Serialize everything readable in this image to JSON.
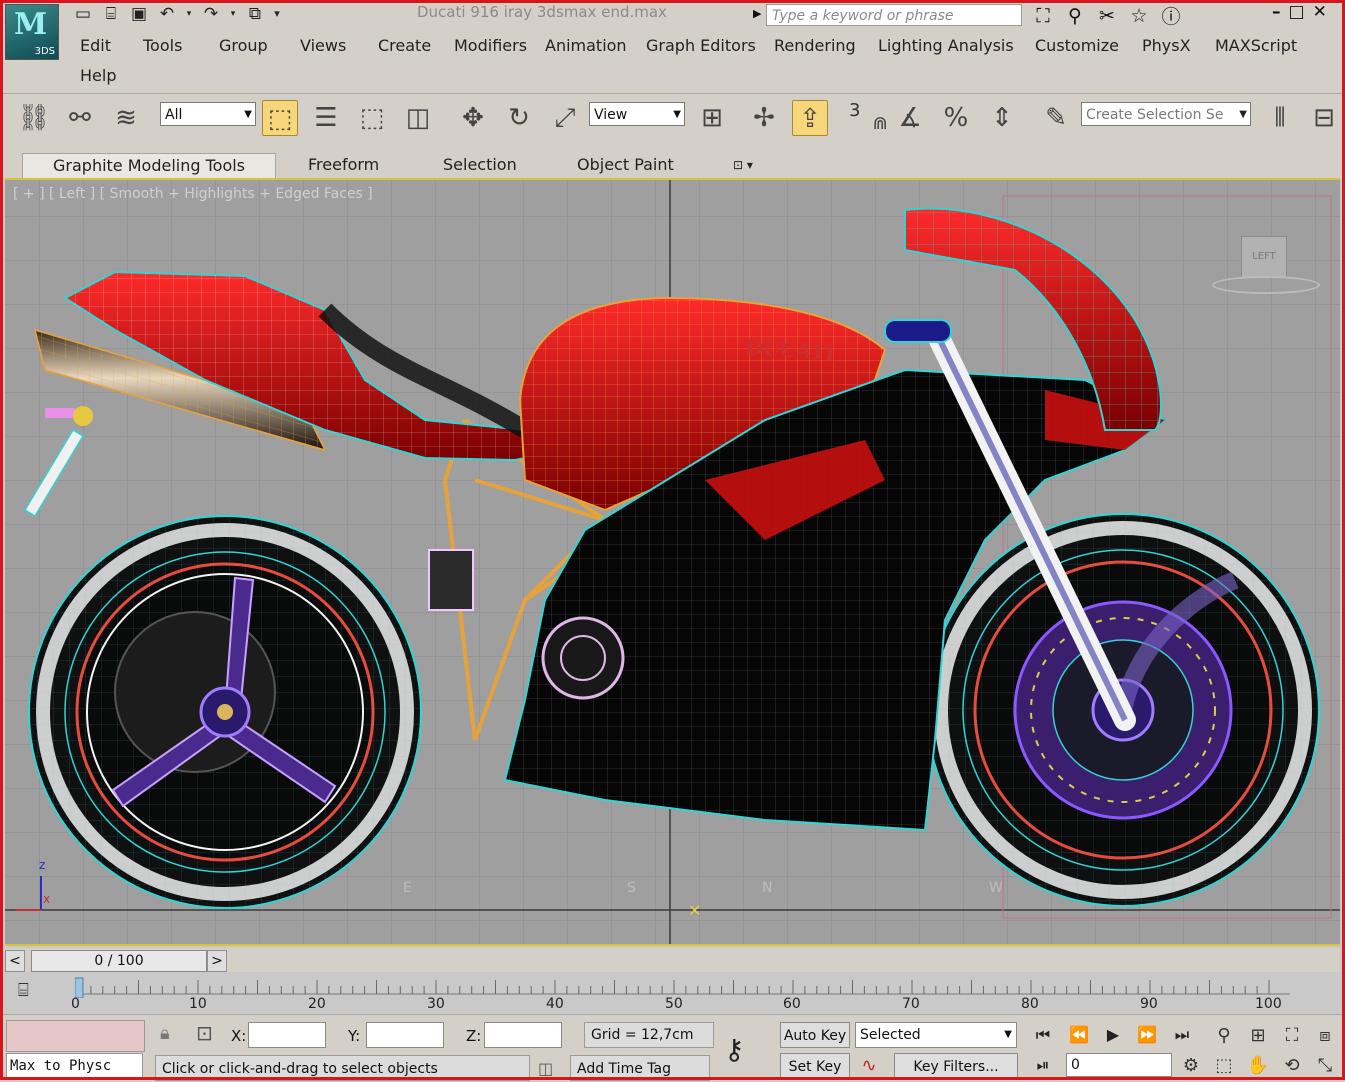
{
  "app": {
    "logo_label": "3DS",
    "window_title": "Ducati 916 iray 3dsmax end.max",
    "search_placeholder": "Type a keyword or phrase"
  },
  "menu": [
    "Edit",
    "Tools",
    "Group",
    "Views",
    "Create",
    "Modifiers",
    "Animation",
    "Graph Editors",
    "Rendering",
    "Lighting Analysis",
    "Customize",
    "PhysX",
    "MAXScript",
    "Help"
  ],
  "toolbar": {
    "selection_filter": "All",
    "reference_coord": "View",
    "snap_number": "3",
    "selection_set_placeholder": "Create Selection Se"
  },
  "ribbon": {
    "tabs": [
      "Graphite Modeling Tools",
      "Freeform",
      "Selection",
      "Object Paint"
    ]
  },
  "viewport": {
    "label_plus": "[ + ]",
    "label_view": "[ Left ]",
    "label_shading": "[ Smooth + Highlights + Edged Faces ]",
    "viewcube_label": "LEFT",
    "compass": [
      "E",
      "S",
      "N",
      "W"
    ],
    "axis_z": "z",
    "axis_x": "x",
    "accent_color": "#d7c23a",
    "wire_colors": [
      "#ff2a2a",
      "#31d4d4",
      "#e8a23c",
      "#8c58ff",
      "#ffffff"
    ]
  },
  "timeline": {
    "frame_display": "0 / 100",
    "prev": "<",
    "next": ">",
    "ruler_labels": [
      "0",
      "10",
      "20",
      "30",
      "40",
      "50",
      "60",
      "70",
      "80",
      "90",
      "100"
    ]
  },
  "status": {
    "maxscript_listener": "Max to Physc",
    "x_label": "X:",
    "y_label": "Y:",
    "z_label": "Z:",
    "grid": "Grid = 12,7cm",
    "prompt": "Click or click-and-drag to select objects",
    "add_time_tag": "Add Time Tag",
    "auto_key": "Auto Key",
    "set_key": "Set Key",
    "key_mode": "Selected",
    "key_filters": "Key Filters...",
    "current_frame": "0"
  }
}
